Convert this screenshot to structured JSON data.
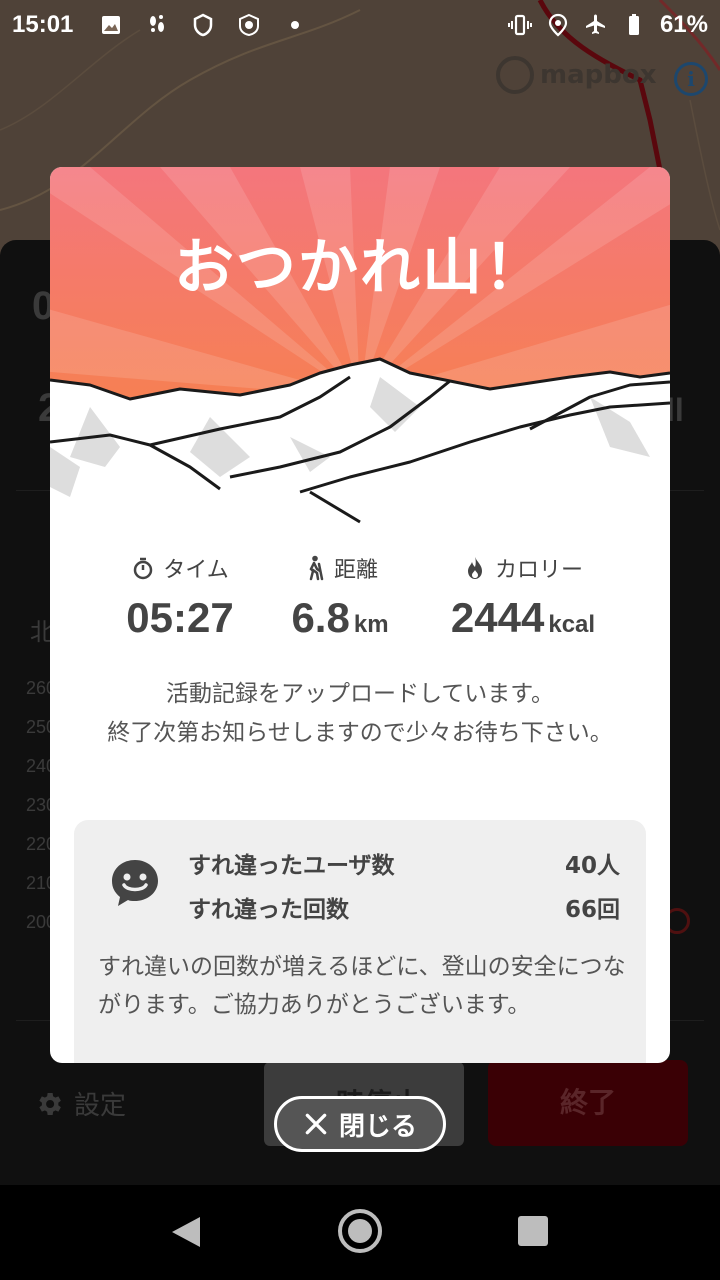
{
  "status_bar": {
    "time": "15:01",
    "battery": "61%",
    "left_icons": [
      "gallery-icon",
      "footsteps-icon",
      "shield-icon",
      "badge-icon",
      "dot-icon"
    ],
    "right_icons": [
      "vibrate-icon",
      "location-icon",
      "airplane-icon",
      "battery-icon"
    ]
  },
  "map": {
    "attribution": "mapbox",
    "info": "i"
  },
  "background_panel": {
    "partial_left_values": [
      "0",
      "2"
    ],
    "partial_right_values": [
      "ll"
    ],
    "partial_label": "北",
    "y_axis_ticks": [
      "260",
      "250",
      "240",
      "230",
      "220",
      "210",
      "200"
    ],
    "settings_label": "設定",
    "pause_label": "一時停止",
    "end_label": "終了"
  },
  "dialog": {
    "title": "おつかれ山！",
    "stats": [
      {
        "icon": "stopwatch-icon",
        "label": "タイム",
        "value": "05:27",
        "unit": ""
      },
      {
        "icon": "hiker-icon",
        "label": "距離",
        "value": "6.8",
        "unit": "km"
      },
      {
        "icon": "flame-icon",
        "label": "カロリー",
        "value": "2444",
        "unit": "kcal"
      }
    ],
    "upload_message_line1": "活動記録をアップロードしています。",
    "upload_message_line2": "終了次第お知らせしますので少々お待ち下さい。",
    "passing": {
      "users_label": "すれ違ったユーザ数",
      "users_value": "40人",
      "count_label": "すれ違った回数",
      "count_value": "66回",
      "note": "すれ違いの回数が増えるほどに、登山の安全につながります。ご協力ありがとうございます。"
    }
  },
  "close_button": {
    "label": "閉じる"
  },
  "colors": {
    "hero_top": "#f4767d",
    "hero_bottom": "#f7853c",
    "end_button": "#5a0008",
    "panel": "#1a1a1a"
  }
}
